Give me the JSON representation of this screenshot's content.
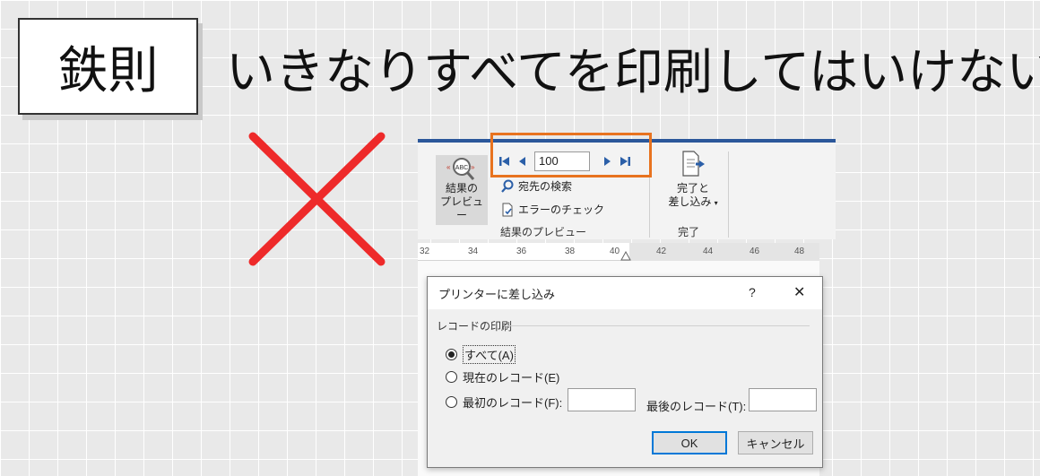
{
  "slide": {
    "tag": "鉄則",
    "headline": "いきなりすべてを印刷してはいけない"
  },
  "ribbon": {
    "preview_button_label_line1": "結果の",
    "preview_button_label_line2": "プレビュー",
    "record_number": "100",
    "find_recipient_label": "宛先の検索",
    "check_errors_label": "エラーのチェック",
    "preview_group_label": "結果のプレビュー",
    "finish_merge_label_line1": "完了と",
    "finish_merge_label_line2": "差し込み",
    "finish_group_label": "完了"
  },
  "ruler": {
    "ticks": [
      "32",
      "34",
      "36",
      "38",
      "40",
      "42",
      "44",
      "46",
      "48"
    ]
  },
  "dialog": {
    "title": "プリンターに差し込み",
    "help": "?",
    "close": "✕",
    "group_label": "レコードの印刷",
    "option_all": "すべて(A)",
    "option_current": "現在のレコード(E)",
    "option_first": "最初のレコード(F):",
    "last_record_label": "最後のレコード(T):",
    "ok_label": "OK",
    "cancel_label": "キャンセル",
    "selected_option": "all"
  },
  "colors": {
    "accent_orange": "#e8731f",
    "ribbon_blue": "#2b579a",
    "cross_red": "#ee2a2a"
  },
  "icons": {
    "preview": "abc-magnifier-icon",
    "find": "magnifier-icon",
    "check": "document-check-icon",
    "finish": "document-arrow-icon",
    "nav": [
      "first-record-icon",
      "previous-record-icon",
      "next-record-icon",
      "last-record-icon"
    ]
  }
}
